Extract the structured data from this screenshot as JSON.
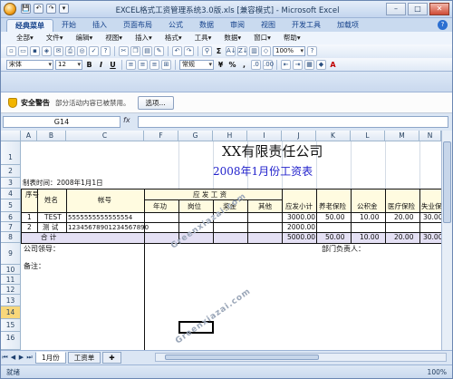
{
  "window": {
    "title": "EXCEL格式工资管理系统3.0版.xls  [兼容模式] - Microsoft Excel"
  },
  "qat": [
    "💾",
    "↶",
    "↷",
    "▾"
  ],
  "ribbon_tabs": [
    "经典菜单",
    "开始",
    "插入",
    "页面布局",
    "公式",
    "数据",
    "审阅",
    "视图",
    "开发工具",
    "加载项"
  ],
  "menus": [
    "全部▾",
    "文件▾",
    "编辑▾",
    "视图▾",
    "插入▾",
    "格式▾",
    "工具▾",
    "数据▾",
    "窗口▾",
    "帮助▾"
  ],
  "toolbar": {
    "font": "宋体",
    "size": "12",
    "bold": "B",
    "italic": "I",
    "underline": "U",
    "number_format": "常规",
    "percent": "%",
    "comma": ",",
    "sum": "Σ",
    "sort": "A↓"
  },
  "security": {
    "title": "安全警告",
    "message": "部分活动内容已被禁用。",
    "options_button": "选项..."
  },
  "formula_bar": {
    "name_box": "G14",
    "fx": "fx",
    "formula": ""
  },
  "columns": [
    "A",
    "B",
    "C",
    "F",
    "G",
    "H",
    "I",
    "J",
    "K",
    "L",
    "M",
    "N"
  ],
  "rows": [
    "1",
    "2",
    "3",
    "4",
    "5",
    "6",
    "7",
    "8",
    "9",
    "10",
    "11",
    "12",
    "13",
    "14",
    "15",
    "16"
  ],
  "sheet": {
    "company": "XX有限责任公司",
    "period_title": "2008年1月份工资表",
    "made_time": "制表时间：2008年1月1日",
    "h_seq": "序号",
    "h_name": "姓名",
    "h_account": "帐号",
    "h_payable": "应 发 工 资",
    "h_seniority": "年功",
    "h_post": "岗位",
    "h_bonus": "奖金",
    "h_other": "其他",
    "h_payable_subtotal": "应发小计",
    "h_pension": "养老保险",
    "h_housing_fund": "公积金",
    "h_medical": "医疗保险",
    "h_unemployment": "失业保",
    "row1": {
      "seq": "1",
      "name": "TEST",
      "account": "5555555555555554",
      "subtotal": "3000.00",
      "pension": "50.00",
      "fund": "10.00",
      "medical": "20.00",
      "unemp": "30.00"
    },
    "row2": {
      "seq": "2",
      "name": "测  试",
      "account": "1234567890123456789​0",
      "subtotal": "2000.00",
      "pension": "",
      "fund": "",
      "medical": "",
      "unemp": ""
    },
    "total": {
      "label": "合  计",
      "subtotal": "5000.00",
      "pension": "50.00",
      "fund": "10.00",
      "medical": "20.00",
      "unemp": "30.00"
    },
    "leader": "公司领导：",
    "note": "备注：",
    "dept_head": "部门负责人："
  },
  "watermark": [
    "Greenxiazai.com",
    "Greenxiazai.com"
  ],
  "sheet_tabs": [
    "1月份",
    "工资单"
  ],
  "status": {
    "text": "就绪",
    "zoom": "100%"
  },
  "colors": {
    "title_blue": "#2222cc",
    "total_band": "#e4e0f4",
    "header_band": "#fffbe0",
    "selected_row": "#f8d77a"
  }
}
